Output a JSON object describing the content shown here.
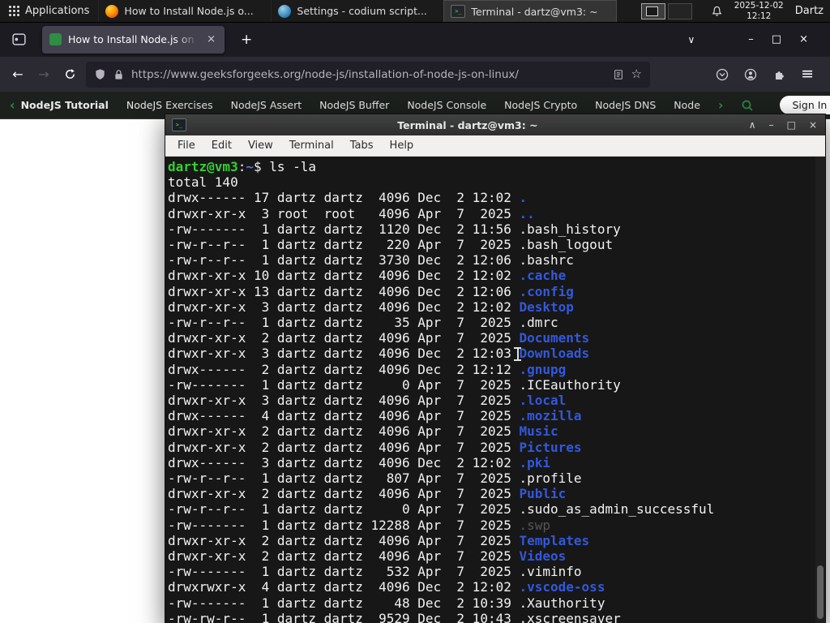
{
  "panel": {
    "applications_label": "Applications",
    "tasks": [
      {
        "title": "How to Install Node.js o..."
      },
      {
        "title": "Settings - codium script..."
      },
      {
        "title": "Terminal - dartz@vm3: ~"
      }
    ],
    "clock_date": "2025-12-02",
    "clock_time": "12:12",
    "user_label": "Dartz"
  },
  "browser": {
    "tab_title": "How to Install Node.js on",
    "url": "https://www.geeksforgeeks.org/node-js/installation-of-node-js-on-linux/"
  },
  "gfg": {
    "accent_color": "#2f8d46",
    "back_label": "NodeJS Tutorial",
    "items": [
      {
        "label": "NodeJS Exercises"
      },
      {
        "label": "NodeJS Assert"
      },
      {
        "label": "NodeJS Buffer"
      },
      {
        "label": "NodeJS Console"
      },
      {
        "label": "NodeJS Crypto"
      },
      {
        "label": "NodeJS DNS"
      },
      {
        "label": "Node"
      }
    ],
    "sign_in_label": "Sign In"
  },
  "terminal": {
    "title": "Terminal - dartz@vm3: ~",
    "menu": [
      {
        "label": "File"
      },
      {
        "label": "Edit"
      },
      {
        "label": "View"
      },
      {
        "label": "Terminal"
      },
      {
        "label": "Tabs"
      },
      {
        "label": "Help"
      }
    ],
    "prompt_host": "dartz@vm3",
    "prompt_colon": ":",
    "prompt_path": "~",
    "prompt_symbol": "$ ",
    "command": "ls -la",
    "total_line": "total 140",
    "colors": {
      "background": "#171717",
      "foreground": "#f2f2f2",
      "prompt_green": "#32d232",
      "directory_blue": "#3358dd",
      "dim_gray": "#555555"
    },
    "rows": [
      {
        "meta": "drwx------ 17 dartz dartz  4096 Dec  2 12:02 ",
        "name": ".",
        "color": "dir"
      },
      {
        "meta": "drwxr-xr-x  3 root  root   4096 Apr  7  2025 ",
        "name": "..",
        "color": "dir"
      },
      {
        "meta": "-rw-------  1 dartz dartz  1120 Dec  2 11:56 ",
        "name": ".bash_history",
        "color": "file"
      },
      {
        "meta": "-rw-r--r--  1 dartz dartz   220 Apr  7  2025 ",
        "name": ".bash_logout",
        "color": "file"
      },
      {
        "meta": "-rw-r--r--  1 dartz dartz  3730 Dec  2 12:06 ",
        "name": ".bashrc",
        "color": "file"
      },
      {
        "meta": "drwxr-xr-x 10 dartz dartz  4096 Dec  2 12:02 ",
        "name": ".cache",
        "color": "dir"
      },
      {
        "meta": "drwxr-xr-x 13 dartz dartz  4096 Dec  2 12:06 ",
        "name": ".config",
        "color": "dir"
      },
      {
        "meta": "drwxr-xr-x  3 dartz dartz  4096 Dec  2 12:02 ",
        "name": "Desktop",
        "color": "dir"
      },
      {
        "meta": "-rw-r--r--  1 dartz dartz    35 Apr  7  2025 ",
        "name": ".dmrc",
        "color": "file"
      },
      {
        "meta": "drwxr-xr-x  2 dartz dartz  4096 Apr  7  2025 ",
        "name": "Documents",
        "color": "dir"
      },
      {
        "meta": "drwxr-xr-x  3 dartz dartz  4096 Dec  2 12:03 ",
        "name": "Downloads",
        "color": "dir"
      },
      {
        "meta": "drwx------  2 dartz dartz  4096 Dec  2 12:12 ",
        "name": ".gnupg",
        "color": "dir"
      },
      {
        "meta": "-rw-------  1 dartz dartz     0 Apr  7  2025 ",
        "name": ".ICEauthority",
        "color": "file"
      },
      {
        "meta": "drwxr-xr-x  3 dartz dartz  4096 Apr  7  2025 ",
        "name": ".local",
        "color": "dir"
      },
      {
        "meta": "drwx------  4 dartz dartz  4096 Apr  7  2025 ",
        "name": ".mozilla",
        "color": "dir"
      },
      {
        "meta": "drwxr-xr-x  2 dartz dartz  4096 Apr  7  2025 ",
        "name": "Music",
        "color": "dir"
      },
      {
        "meta": "drwxr-xr-x  2 dartz dartz  4096 Apr  7  2025 ",
        "name": "Pictures",
        "color": "dir"
      },
      {
        "meta": "drwx------  3 dartz dartz  4096 Dec  2 12:02 ",
        "name": ".pki",
        "color": "dir"
      },
      {
        "meta": "-rw-r--r--  1 dartz dartz   807 Apr  7  2025 ",
        "name": ".profile",
        "color": "file"
      },
      {
        "meta": "drwxr-xr-x  2 dartz dartz  4096 Apr  7  2025 ",
        "name": "Public",
        "color": "dir"
      },
      {
        "meta": "-rw-r--r--  1 dartz dartz     0 Apr  7  2025 ",
        "name": ".sudo_as_admin_successful",
        "color": "file"
      },
      {
        "meta": "-rw-------  1 dartz dartz 12288 Apr  7  2025 ",
        "name": ".swp",
        "color": "dim"
      },
      {
        "meta": "drwxr-xr-x  2 dartz dartz  4096 Apr  7  2025 ",
        "name": "Templates",
        "color": "dir"
      },
      {
        "meta": "drwxr-xr-x  2 dartz dartz  4096 Apr  7  2025 ",
        "name": "Videos",
        "color": "dir"
      },
      {
        "meta": "-rw-------  1 dartz dartz   532 Apr  7  2025 ",
        "name": ".viminfo",
        "color": "file"
      },
      {
        "meta": "drwxrwxr-x  4 dartz dartz  4096 Dec  2 12:02 ",
        "name": ".vscode-oss",
        "color": "dir"
      },
      {
        "meta": "-rw-------  1 dartz dartz    48 Dec  2 10:39 ",
        "name": ".Xauthority",
        "color": "file"
      },
      {
        "meta": "-rw-rw-r--  1 dartz dartz  9529 Dec  2 10:43 ",
        "name": ".xscreensaver",
        "color": "file"
      }
    ]
  },
  "icons": {
    "terminal_glyph": ">_",
    "close": "×",
    "minimize": "–",
    "maximize": "□",
    "shade": "∧",
    "tab_list": "∨",
    "new_tab": "+",
    "back": "←",
    "forward": "→",
    "chevron_left": "‹",
    "chevron_right": "›",
    "star": "☆",
    "hamburger": "≡"
  }
}
